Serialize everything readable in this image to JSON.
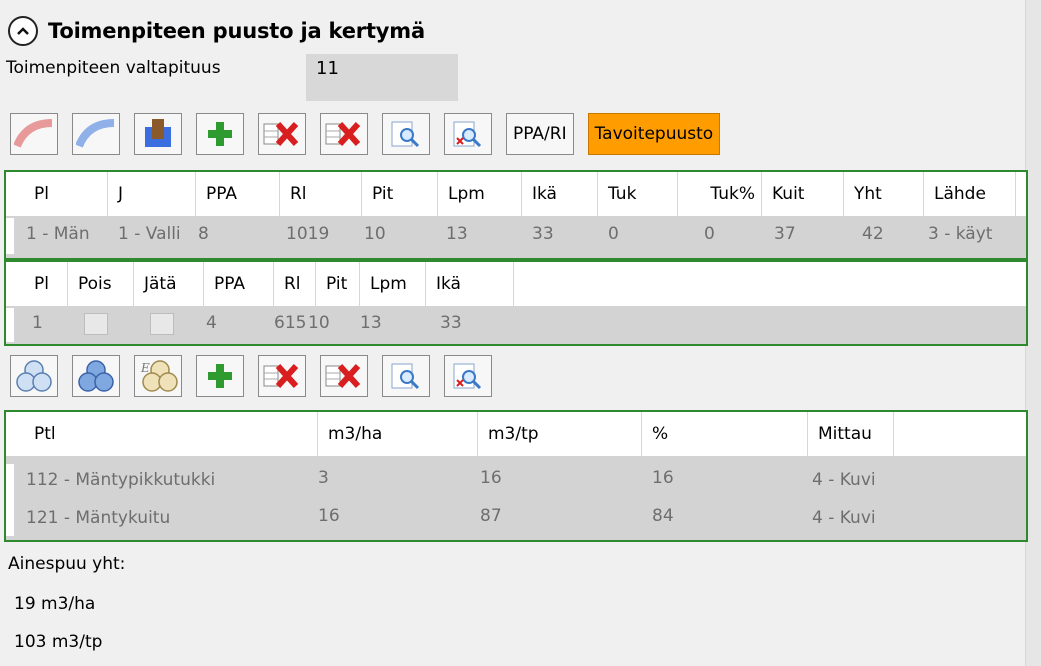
{
  "section": {
    "title": "Toimenpiteen puusto ja kertymä"
  },
  "valtapituus": {
    "label": "Toimenpiteen valtapituus",
    "value": "11"
  },
  "toolbar1": {
    "icons": [
      "red-curve-icon",
      "blue-curve-icon",
      "tree-stand-icon",
      "add-icon",
      "delete-row-icon",
      "delete-all-icon",
      "zoom-icon",
      "zoom-remove-icon"
    ],
    "ppa_ri_label": "PPA/RI",
    "tavoitepuusto_label": "Tavoitepuusto",
    "accent": "#ff9c00"
  },
  "grid1": {
    "columns": [
      "Pl",
      "J",
      "PPA",
      "Rl",
      "Pit",
      "Lpm",
      "Ikä",
      "Tuk",
      "Tuk%",
      "Kuit",
      "Yht",
      "Lähde"
    ],
    "rows": [
      [
        "1 - Män",
        "1 - Valli",
        "8",
        "1019",
        "10",
        "13",
        "33",
        "0",
        "0",
        "37",
        "42",
        "3 - käyt"
      ]
    ]
  },
  "grid2": {
    "columns": [
      "Pl",
      "Pois",
      "Jätä",
      "PPA",
      "Rl",
      "Pit",
      "Lpm",
      "Ikä"
    ],
    "rows": [
      {
        "pl": "1",
        "pois": false,
        "jata": false,
        "ppa": "4",
        "rl": "615",
        "pit": "10",
        "lpm": "13",
        "ika": "33"
      }
    ]
  },
  "toolbar2": {
    "icons": [
      "circles-icon",
      "circles-blue-icon",
      "circles-edit-icon",
      "add-icon",
      "delete-row-icon",
      "delete-all-icon",
      "zoom-icon",
      "zoom-remove-icon"
    ]
  },
  "grid3": {
    "columns": [
      "Ptl",
      "m3/ha",
      "m3/tp",
      "%",
      "Mittau"
    ],
    "rows": [
      [
        "112 - Mäntypikkutukki",
        "3",
        "16",
        "16",
        "4 - Kuvi"
      ],
      [
        "121 - Mäntykuitu",
        "16",
        "87",
        "84",
        "4 - Kuvi"
      ]
    ]
  },
  "summary": {
    "label": "Ainespuu yht:",
    "per_ha": "19 m3/ha",
    "per_tp": "103 m3/tp"
  }
}
